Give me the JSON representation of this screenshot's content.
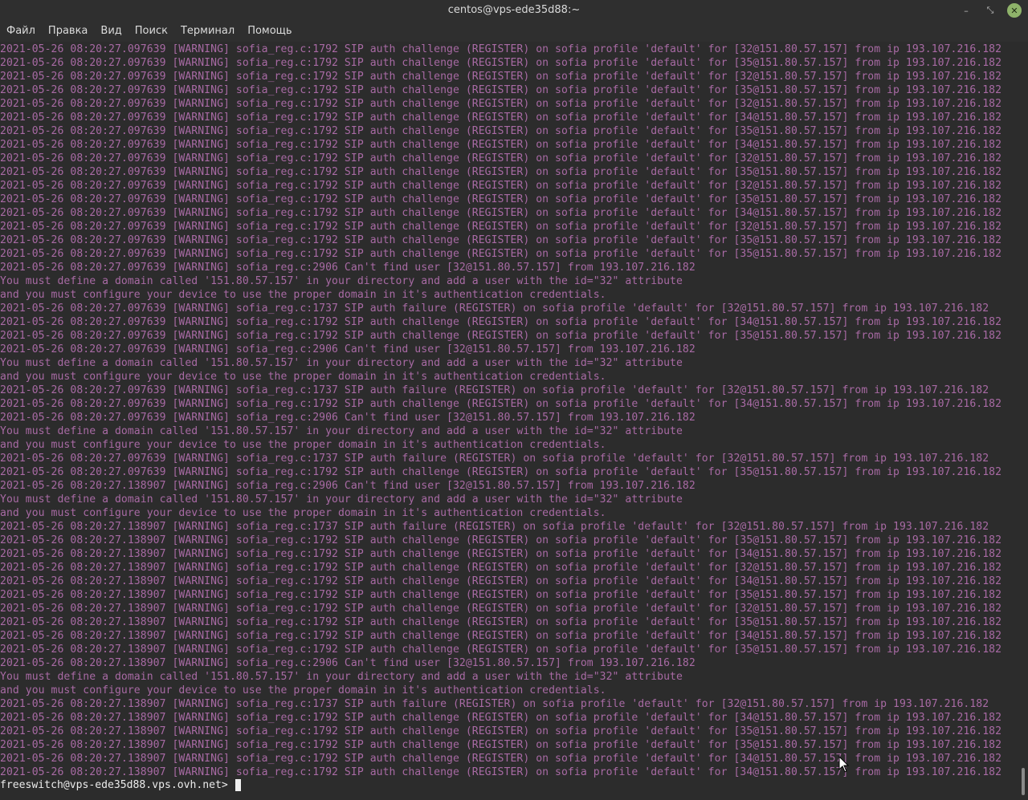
{
  "window": {
    "title": "centos@vps-ede35d88:~",
    "minimize_icon": "minimize-icon",
    "maximize_icon": "maximize-icon",
    "close_icon": "close-icon",
    "minimize_glyph": "–",
    "maximize_glyph": "⤡",
    "close_glyph": "✕",
    "close_color": "#8fb36a"
  },
  "menu": {
    "items": [
      "Файл",
      "Правка",
      "Вид",
      "Поиск",
      "Терминал",
      "Помощь"
    ]
  },
  "terminal": {
    "log_color": "#a86aa4",
    "lines": [
      "2021-05-26 08:20:27.097639 [WARNING] sofia_reg.c:1792 SIP auth challenge (REGISTER) on sofia profile 'default' for [32@151.80.57.157] from ip 193.107.216.182",
      "2021-05-26 08:20:27.097639 [WARNING] sofia_reg.c:1792 SIP auth challenge (REGISTER) on sofia profile 'default' for [35@151.80.57.157] from ip 193.107.216.182",
      "2021-05-26 08:20:27.097639 [WARNING] sofia_reg.c:1792 SIP auth challenge (REGISTER) on sofia profile 'default' for [32@151.80.57.157] from ip 193.107.216.182",
      "2021-05-26 08:20:27.097639 [WARNING] sofia_reg.c:1792 SIP auth challenge (REGISTER) on sofia profile 'default' for [35@151.80.57.157] from ip 193.107.216.182",
      "2021-05-26 08:20:27.097639 [WARNING] sofia_reg.c:1792 SIP auth challenge (REGISTER) on sofia profile 'default' for [32@151.80.57.157] from ip 193.107.216.182",
      "2021-05-26 08:20:27.097639 [WARNING] sofia_reg.c:1792 SIP auth challenge (REGISTER) on sofia profile 'default' for [34@151.80.57.157] from ip 193.107.216.182",
      "2021-05-26 08:20:27.097639 [WARNING] sofia_reg.c:1792 SIP auth challenge (REGISTER) on sofia profile 'default' for [35@151.80.57.157] from ip 193.107.216.182",
      "2021-05-26 08:20:27.097639 [WARNING] sofia_reg.c:1792 SIP auth challenge (REGISTER) on sofia profile 'default' for [34@151.80.57.157] from ip 193.107.216.182",
      "2021-05-26 08:20:27.097639 [WARNING] sofia_reg.c:1792 SIP auth challenge (REGISTER) on sofia profile 'default' for [32@151.80.57.157] from ip 193.107.216.182",
      "2021-05-26 08:20:27.097639 [WARNING] sofia_reg.c:1792 SIP auth challenge (REGISTER) on sofia profile 'default' for [35@151.80.57.157] from ip 193.107.216.182",
      "2021-05-26 08:20:27.097639 [WARNING] sofia_reg.c:1792 SIP auth challenge (REGISTER) on sofia profile 'default' for [32@151.80.57.157] from ip 193.107.216.182",
      "2021-05-26 08:20:27.097639 [WARNING] sofia_reg.c:1792 SIP auth challenge (REGISTER) on sofia profile 'default' for [35@151.80.57.157] from ip 193.107.216.182",
      "2021-05-26 08:20:27.097639 [WARNING] sofia_reg.c:1792 SIP auth challenge (REGISTER) on sofia profile 'default' for [34@151.80.57.157] from ip 193.107.216.182",
      "2021-05-26 08:20:27.097639 [WARNING] sofia_reg.c:1792 SIP auth challenge (REGISTER) on sofia profile 'default' for [32@151.80.57.157] from ip 193.107.216.182",
      "2021-05-26 08:20:27.097639 [WARNING] sofia_reg.c:1792 SIP auth challenge (REGISTER) on sofia profile 'default' for [35@151.80.57.157] from ip 193.107.216.182",
      "2021-05-26 08:20:27.097639 [WARNING] sofia_reg.c:1792 SIP auth challenge (REGISTER) on sofia profile 'default' for [35@151.80.57.157] from ip 193.107.216.182",
      "2021-05-26 08:20:27.097639 [WARNING] sofia_reg.c:2906 Can't find user [32@151.80.57.157] from 193.107.216.182",
      "You must define a domain called '151.80.57.157' in your directory and add a user with the id=\"32\" attribute",
      "and you must configure your device to use the proper domain in it's authentication credentials.",
      "2021-05-26 08:20:27.097639 [WARNING] sofia_reg.c:1737 SIP auth failure (REGISTER) on sofia profile 'default' for [32@151.80.57.157] from ip 193.107.216.182",
      "2021-05-26 08:20:27.097639 [WARNING] sofia_reg.c:1792 SIP auth challenge (REGISTER) on sofia profile 'default' for [34@151.80.57.157] from ip 193.107.216.182",
      "2021-05-26 08:20:27.097639 [WARNING] sofia_reg.c:1792 SIP auth challenge (REGISTER) on sofia profile 'default' for [35@151.80.57.157] from ip 193.107.216.182",
      "2021-05-26 08:20:27.097639 [WARNING] sofia_reg.c:2906 Can't find user [32@151.80.57.157] from 193.107.216.182",
      "You must define a domain called '151.80.57.157' in your directory and add a user with the id=\"32\" attribute",
      "and you must configure your device to use the proper domain in it's authentication credentials.",
      "2021-05-26 08:20:27.097639 [WARNING] sofia_reg.c:1737 SIP auth failure (REGISTER) on sofia profile 'default' for [32@151.80.57.157] from ip 193.107.216.182",
      "2021-05-26 08:20:27.097639 [WARNING] sofia_reg.c:1792 SIP auth challenge (REGISTER) on sofia profile 'default' for [34@151.80.57.157] from ip 193.107.216.182",
      "2021-05-26 08:20:27.097639 [WARNING] sofia_reg.c:2906 Can't find user [32@151.80.57.157] from 193.107.216.182",
      "You must define a domain called '151.80.57.157' in your directory and add a user with the id=\"32\" attribute",
      "and you must configure your device to use the proper domain in it's authentication credentials.",
      "2021-05-26 08:20:27.097639 [WARNING] sofia_reg.c:1737 SIP auth failure (REGISTER) on sofia profile 'default' for [32@151.80.57.157] from ip 193.107.216.182",
      "2021-05-26 08:20:27.097639 [WARNING] sofia_reg.c:1792 SIP auth challenge (REGISTER) on sofia profile 'default' for [35@151.80.57.157] from ip 193.107.216.182",
      "2021-05-26 08:20:27.138907 [WARNING] sofia_reg.c:2906 Can't find user [32@151.80.57.157] from 193.107.216.182",
      "You must define a domain called '151.80.57.157' in your directory and add a user with the id=\"32\" attribute",
      "and you must configure your device to use the proper domain in it's authentication credentials.",
      "2021-05-26 08:20:27.138907 [WARNING] sofia_reg.c:1737 SIP auth failure (REGISTER) on sofia profile 'default' for [32@151.80.57.157] from ip 193.107.216.182",
      "2021-05-26 08:20:27.138907 [WARNING] sofia_reg.c:1792 SIP auth challenge (REGISTER) on sofia profile 'default' for [35@151.80.57.157] from ip 193.107.216.182",
      "2021-05-26 08:20:27.138907 [WARNING] sofia_reg.c:1792 SIP auth challenge (REGISTER) on sofia profile 'default' for [34@151.80.57.157] from ip 193.107.216.182",
      "2021-05-26 08:20:27.138907 [WARNING] sofia_reg.c:1792 SIP auth challenge (REGISTER) on sofia profile 'default' for [32@151.80.57.157] from ip 193.107.216.182",
      "2021-05-26 08:20:27.138907 [WARNING] sofia_reg.c:1792 SIP auth challenge (REGISTER) on sofia profile 'default' for [34@151.80.57.157] from ip 193.107.216.182",
      "2021-05-26 08:20:27.138907 [WARNING] sofia_reg.c:1792 SIP auth challenge (REGISTER) on sofia profile 'default' for [35@151.80.57.157] from ip 193.107.216.182",
      "2021-05-26 08:20:27.138907 [WARNING] sofia_reg.c:1792 SIP auth challenge (REGISTER) on sofia profile 'default' for [32@151.80.57.157] from ip 193.107.216.182",
      "2021-05-26 08:20:27.138907 [WARNING] sofia_reg.c:1792 SIP auth challenge (REGISTER) on sofia profile 'default' for [35@151.80.57.157] from ip 193.107.216.182",
      "2021-05-26 08:20:27.138907 [WARNING] sofia_reg.c:1792 SIP auth challenge (REGISTER) on sofia profile 'default' for [34@151.80.57.157] from ip 193.107.216.182",
      "2021-05-26 08:20:27.138907 [WARNING] sofia_reg.c:1792 SIP auth challenge (REGISTER) on sofia profile 'default' for [35@151.80.57.157] from ip 193.107.216.182",
      "2021-05-26 08:20:27.138907 [WARNING] sofia_reg.c:2906 Can't find user [32@151.80.57.157] from 193.107.216.182",
      "You must define a domain called '151.80.57.157' in your directory and add a user with the id=\"32\" attribute",
      "and you must configure your device to use the proper domain in it's authentication credentials.",
      "2021-05-26 08:20:27.138907 [WARNING] sofia_reg.c:1737 SIP auth failure (REGISTER) on sofia profile 'default' for [32@151.80.57.157] from ip 193.107.216.182",
      "2021-05-26 08:20:27.138907 [WARNING] sofia_reg.c:1792 SIP auth challenge (REGISTER) on sofia profile 'default' for [34@151.80.57.157] from ip 193.107.216.182",
      "2021-05-26 08:20:27.138907 [WARNING] sofia_reg.c:1792 SIP auth challenge (REGISTER) on sofia profile 'default' for [35@151.80.57.157] from ip 193.107.216.182",
      "2021-05-26 08:20:27.138907 [WARNING] sofia_reg.c:1792 SIP auth challenge (REGISTER) on sofia profile 'default' for [35@151.80.57.157] from ip 193.107.216.182",
      "2021-05-26 08:20:27.138907 [WARNING] sofia_reg.c:1792 SIP auth challenge (REGISTER) on sofia profile 'default' for [34@151.80.57.157] from ip 193.107.216.182",
      "2021-05-26 08:20:27.138907 [WARNING] sofia_reg.c:1792 SIP auth challenge (REGISTER) on sofia profile 'default' for [34@151.80.57.157] from ip 193.107.216.182"
    ],
    "prompt": "freeswitch@vps-ede35d88.vps.ovh.net> ",
    "input_value": ""
  }
}
